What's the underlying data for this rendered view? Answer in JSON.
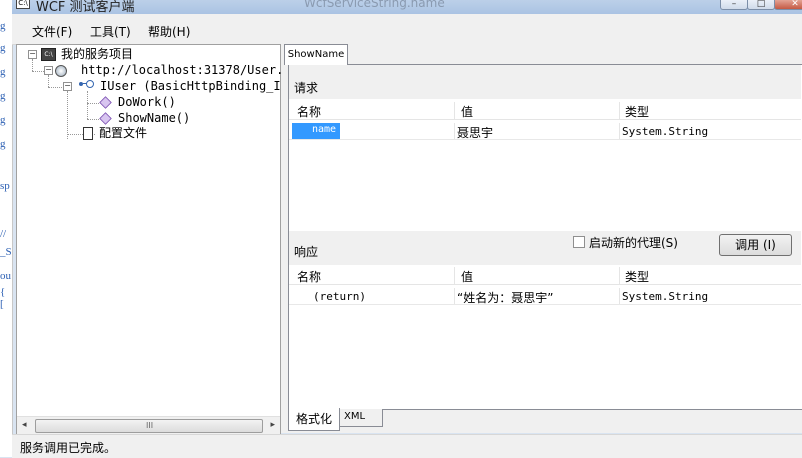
{
  "window": {
    "title": "WCF 测试客户端",
    "background_title": "WcfServiceString.name",
    "app_icon_text": "C:\\",
    "minimize_glyph": "–",
    "maximize_glyph": "□",
    "close_glyph": "✕"
  },
  "menu": {
    "file": "文件(F)",
    "tools": "工具(T)",
    "help": "帮助(H)"
  },
  "tree": {
    "root_label": "我的服务项目",
    "endpoint_label": "http://localhost:31378/User.svc",
    "contract_label": "IUser (BasicHttpBinding_IUser)",
    "operations": [
      "DoWork()",
      "ShowName()"
    ],
    "config_label": "配置文件",
    "scroll_left": "◂",
    "scroll_right": "▸",
    "scroll_grip": "III",
    "toggle_minus": "−"
  },
  "tab": {
    "title": "ShowName"
  },
  "request": {
    "section_label": "请求",
    "headers": [
      "名称",
      "值",
      "类型"
    ],
    "rows": [
      {
        "name": "name",
        "value": "聂思宇",
        "type": "System.String"
      }
    ]
  },
  "response": {
    "section_label": "响应",
    "new_proxy_label": "启动新的代理(S)",
    "invoke_label": "调用 (I)",
    "headers": [
      "名称",
      "值",
      "类型"
    ],
    "rows": [
      {
        "name": "(return)",
        "value": "“姓名为：聂思宇”",
        "type": "System.String"
      }
    ]
  },
  "bottom_tabs": {
    "formatted": "格式化",
    "xml": "XML"
  },
  "status": {
    "text": "服务调用已完成。"
  },
  "colors": {
    "selection": "#3399ff",
    "chrome": "#f0f0f0",
    "titlebar": "#bcd0e9"
  }
}
